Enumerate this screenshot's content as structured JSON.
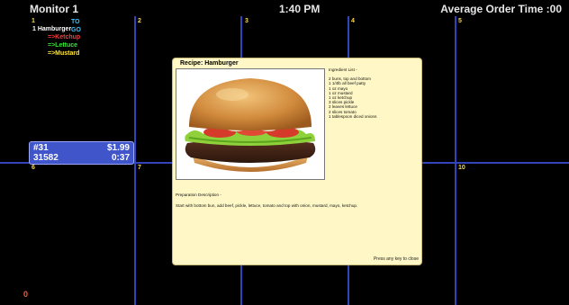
{
  "header": {
    "monitor": "Monitor 1",
    "clock": "1:40 PM",
    "avg_order_time": "Average Order Time  :00"
  },
  "cells": [
    "1",
    "2",
    "3",
    "4",
    "5",
    "6",
    "7",
    "10"
  ],
  "order_cell1": {
    "item": "1  Hamburger",
    "order_type": "TO GO",
    "modifiers": [
      "=>Ketchup",
      "=>Lettuce",
      "=>Mustard"
    ]
  },
  "ticket": {
    "number": "#31",
    "price": "$1.99",
    "id": "31582",
    "time": "0:37"
  },
  "footer": {
    "count": "0"
  },
  "recipe": {
    "title": "Recipe: Hamburger",
    "ingredient_header": "Ingredient List -",
    "ingredients": [
      "2 buns, top and bottom",
      "1 1/4lb all beef patty",
      "1 oz mayo",
      "1 oz mustard",
      "1 oz ketchup",
      "3 slices pickle",
      "2 leaves lettuce",
      "2 slices tomato",
      "1 tablespoon diced onions"
    ],
    "prep_header": "Preparation Description -",
    "prep_text": "Start with bottom bun, add beef, pickle, lettuce, tomato and top with onion, mustard, mayo, ketchup.",
    "close_hint": "Press any key to close"
  },
  "colors": {
    "grid": "#3344bb",
    "cell_number": "#ffd84a",
    "ticket_bg": "#3f55c9",
    "popup_bg": "#fff8c6"
  }
}
